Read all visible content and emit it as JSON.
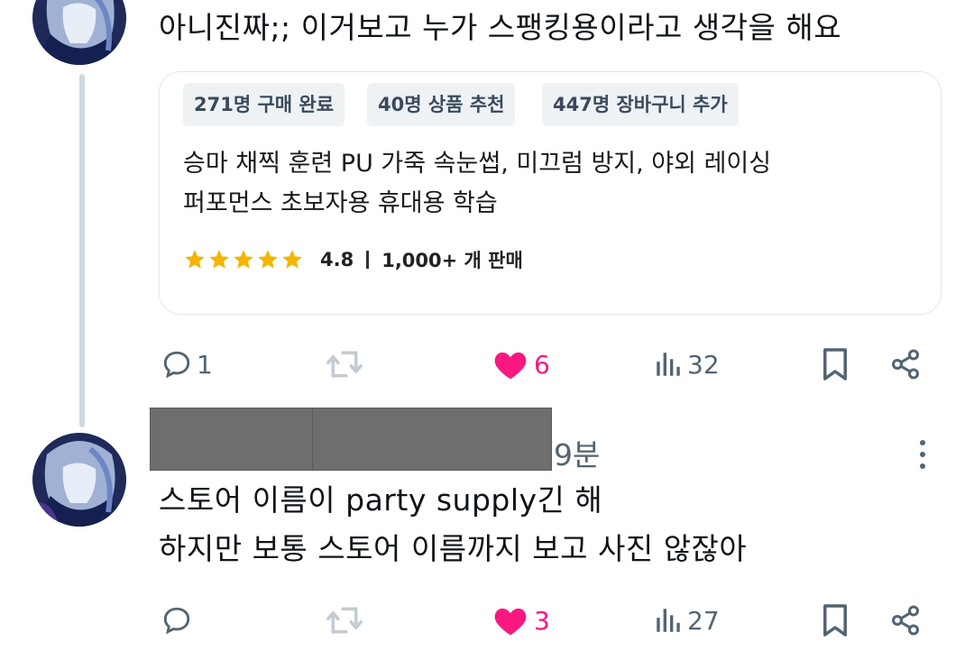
{
  "thread": {
    "first_reply": {
      "text": "아니진짜;; 이거보고 누가 스팽킹용이라고 생각을 해요",
      "card": {
        "badges": [
          "271명 구매 완료",
          "40명 상품 추천",
          "447명 장바구니 추가"
        ],
        "title_line1": "승마 채찍 훈련 PU 가죽 속눈썹, 미끄럼 방지, 야외 레이싱",
        "title_line2": "퍼포먼스 초보자용 휴대용 학습",
        "rating": "4.8",
        "sold": "1,000+ 개 판매",
        "stars": 5
      },
      "actions": {
        "reply_count": "1",
        "retweet_count": "",
        "like_count": "6",
        "view_count": "32"
      }
    },
    "second_reply": {
      "timestamp": "9분",
      "text_line1": "스토어 이름이 party supply긴 해",
      "text_line2": "하지만 보통 스토어 이름까지 보고 사진 않잖아",
      "actions": {
        "reply_count": "",
        "retweet_count": "",
        "like_count": "3",
        "view_count": "27"
      }
    }
  },
  "colors": {
    "like": "#f91880",
    "muted": "#536471",
    "star": "#f5b400"
  }
}
